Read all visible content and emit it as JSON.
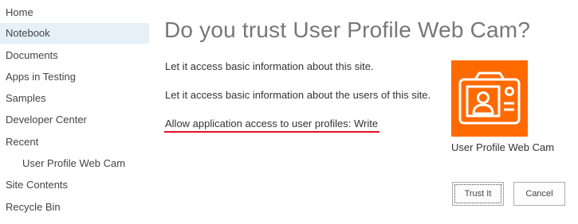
{
  "nav": {
    "items": [
      {
        "label": "Home"
      },
      {
        "label": "Notebook",
        "selected": true
      },
      {
        "label": "Documents"
      },
      {
        "label": "Apps in Testing"
      },
      {
        "label": "Samples"
      },
      {
        "label": "Developer Center"
      },
      {
        "label": "Recent"
      },
      {
        "label": "User Profile Web Cam"
      },
      {
        "label": "Site Contents"
      },
      {
        "label": "Recycle Bin"
      }
    ]
  },
  "dialog": {
    "title": "Do you trust User Profile Web Cam?",
    "permissions": [
      "Let it access basic information about this site.",
      "Let it access basic information about the users of this site.",
      "Allow application access to user profiles: Write"
    ],
    "app": {
      "name": "User Profile Web Cam",
      "icon": "camera-profile-icon",
      "icon_color": "#ff6a00"
    },
    "buttons": {
      "trust_label": "Trust It",
      "cancel_label": "Cancel"
    },
    "highlight_color": "#e81123"
  }
}
